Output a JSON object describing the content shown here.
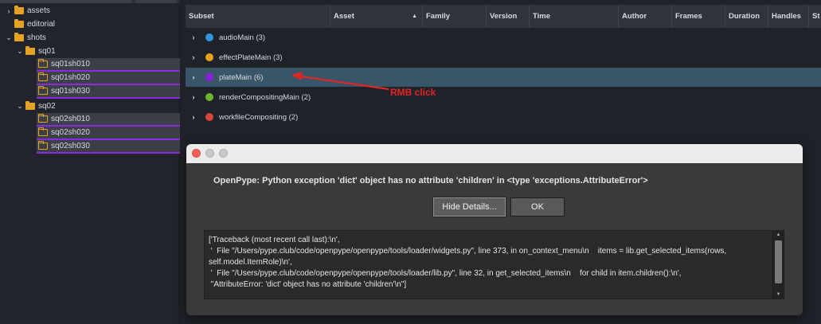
{
  "tree": {
    "items": [
      {
        "label": "assets",
        "arrow": "›"
      },
      {
        "label": "editorial",
        "arrow": ""
      },
      {
        "label": "shots",
        "arrow": "⌄"
      },
      {
        "label": "sq01",
        "arrow": "⌄"
      },
      {
        "label": "sq01sh010",
        "arrow": ""
      },
      {
        "label": "sq01sh020",
        "arrow": ""
      },
      {
        "label": "sq01sh030",
        "arrow": ""
      },
      {
        "label": "sq02",
        "arrow": "⌄"
      },
      {
        "label": "sq02sh010",
        "arrow": ""
      },
      {
        "label": "sq02sh020",
        "arrow": ""
      },
      {
        "label": "sq02sh030",
        "arrow": ""
      }
    ]
  },
  "table": {
    "columns": [
      "Subset",
      "Asset",
      "Family",
      "Version",
      "Time",
      "Author",
      "Frames",
      "Duration",
      "Handles",
      "St"
    ],
    "rows": [
      {
        "label": "audioMain (3)",
        "color": "#2f95db"
      },
      {
        "label": "effectPlateMain (3)",
        "color": "#e5a21b"
      },
      {
        "label": "plateMain (6)",
        "color": "#8a1fe0"
      },
      {
        "label": "renderCompositingMain (2)",
        "color": "#6cb52d"
      },
      {
        "label": "workfileCompositing (2)",
        "color": "#d9473a"
      }
    ]
  },
  "annotation": {
    "text": "RMB click",
    "color": "#e02525"
  },
  "dialog": {
    "message": "OpenPype: Python exception 'dict' object has no attribute 'children' in <type 'exceptions.AttributeError'>",
    "hide_details_label": "Hide Details...",
    "ok_label": "OK",
    "details": "['Traceback (most recent call last):\\n',\n '  File \"/Users/pype.club/code/openpype/openpype/tools/loader/widgets.py\", line 373, in on_context_menu\\n    items = lib.get_selected_items(rows, self.model.ItemRole)\\n',\n '  File \"/Users/pype.club/code/openpype/openpype/tools/loader/lib.py\", line 32, in get_selected_items\\n    for child in item.children():\\n',\n \"AttributeError: 'dict' object has no attribute 'children'\\n\"]"
  }
}
